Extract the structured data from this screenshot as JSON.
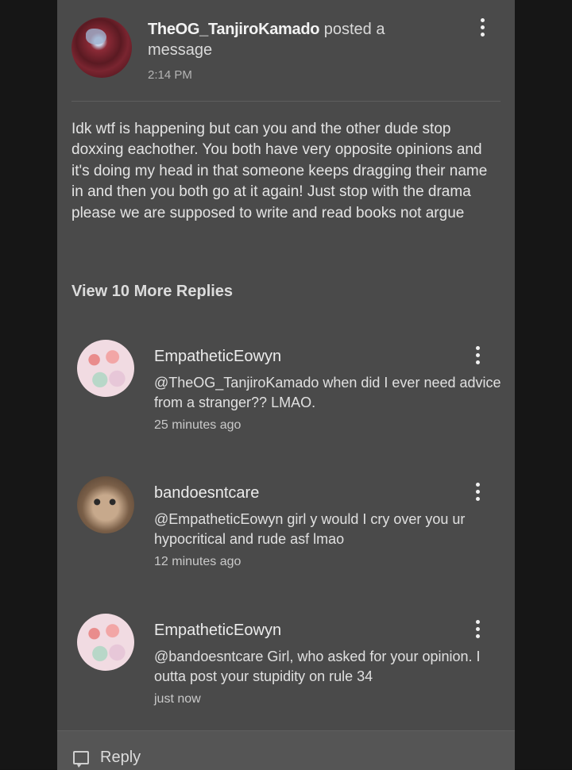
{
  "post": {
    "author": "TheOG_TanjiroKamado",
    "action": "posted a message",
    "time": "2:14 PM",
    "body": "Idk wtf is happening but can you and the other dude stop doxxing eachother. You both have very opposite opinions and it's doing my head in that someone keeps dragging their name in and then you both go at it again! Just stop with the drama please we are supposed to write and read books not argue"
  },
  "view_more_label": "View 10 More Replies",
  "replies": [
    {
      "author": "EmpatheticEowyn",
      "text": "@TheOG_TanjiroKamado when did I ever need advice from a stranger?? LMAO.",
      "time": "25 minutes ago"
    },
    {
      "author": "bandoesntcare",
      "text": "@EmpatheticEowyn girl y would I cry over you ur hypocritical and rude asf lmao",
      "time": "12 minutes ago"
    },
    {
      "author": "EmpatheticEowyn",
      "text": "@bandoesntcare Girl, who asked for your opinion. I outta post your stupidity on rule 34",
      "time": "just now"
    }
  ],
  "reply_bar": {
    "label": "Reply",
    "icon": "comment-icon"
  },
  "colors": {
    "panel": "#4a4a4a",
    "background": "#141414",
    "text": "#e6e6e6"
  }
}
